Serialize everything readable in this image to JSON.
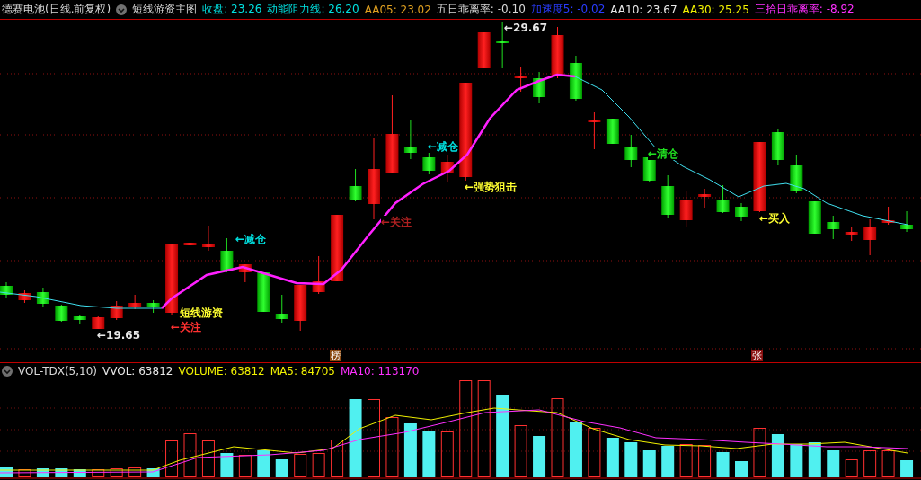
{
  "header": {
    "title": "德赛电池(日线.前复权)",
    "indicator": "短线游资主图",
    "readouts": [
      {
        "text": "收盘: 23.26",
        "color": "#00e0e0"
      },
      {
        "text": "动能阻力线: 26.20",
        "color": "#00e0e0"
      },
      {
        "text": "AA05: 23.02",
        "color": "#e0a020"
      },
      {
        "text": "五日乖离率: -0.10",
        "color": "#d8d8d8"
      },
      {
        "text": "加速度5: -0.02",
        "color": "#2a3cff"
      },
      {
        "text": "AA10: 23.67",
        "color": "#e8e8e8"
      },
      {
        "text": "AA30: 25.25",
        "color": "#f0f000"
      },
      {
        "text": "三拾日乖离率: -8.92",
        "color": "#ff30ff"
      }
    ]
  },
  "annotations": [
    {
      "text": "←29.67",
      "color": "#e8e8e8"
    },
    {
      "text": "←减仓",
      "color": "#00e0e0"
    },
    {
      "text": "短线游资",
      "color": "#ffff30"
    },
    {
      "text": "←关注",
      "color": "#ff3030"
    },
    {
      "text": "←19.65",
      "color": "#e8e8e8"
    },
    {
      "text": "←关注",
      "color": "#b02020"
    },
    {
      "text": "←减仓",
      "color": "#00e0e0"
    },
    {
      "text": "←强势狙击",
      "color": "#ffff30"
    },
    {
      "text": "←清仓",
      "color": "#20e020"
    },
    {
      "text": "←买入",
      "color": "#ffff30"
    }
  ],
  "badges": [
    {
      "text": "榜",
      "color": "#8a4a10"
    },
    {
      "text": "张",
      "color": "#8a1010"
    }
  ],
  "volume": {
    "indicator": "VOL-TDX(5,10)",
    "readouts": [
      {
        "text": "VVOL: 63812",
        "color": "#e8e8e8"
      },
      {
        "text": "VOLUME: 63812",
        "color": "#f0f000"
      },
      {
        "text": "MA5: 84705",
        "color": "#f0f000"
      },
      {
        "text": "MA10: 113170",
        "color": "#ff30ff"
      }
    ]
  }
}
